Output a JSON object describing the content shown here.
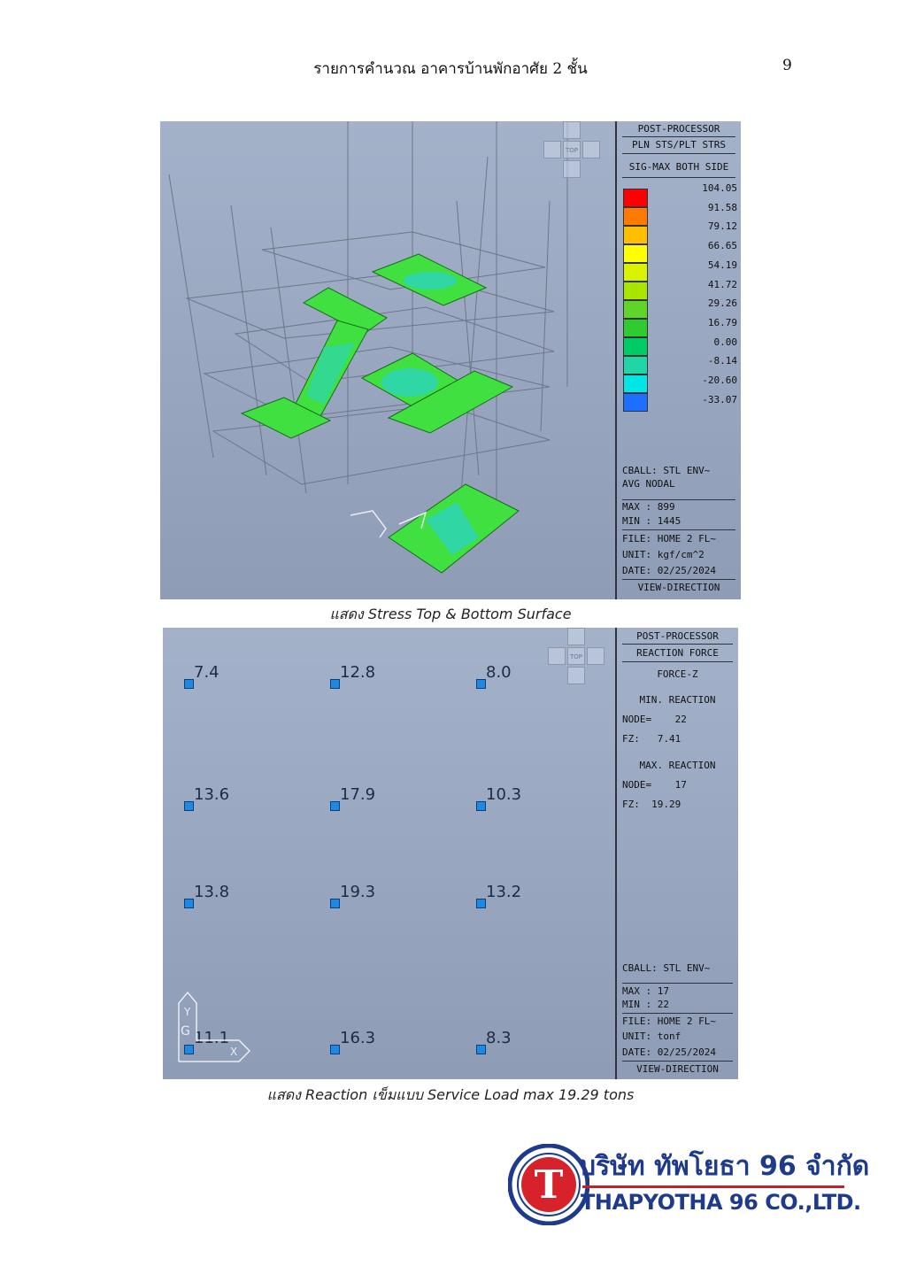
{
  "header": {
    "title": "รายการคำนวณ อาคารบ้านพักอาศัย 2 ชั้น",
    "page_number": "9"
  },
  "view_cube": {
    "top_label": "TOP"
  },
  "panel_stress": {
    "processor": "POST-PROCESSOR",
    "mode": "PLN STS/PLT STRS",
    "component": "SIG-MAX BOTH SIDE",
    "legend": [
      {
        "value": "104.05",
        "color": "#ff0000"
      },
      {
        "value": "91.58",
        "color": "#ff7a00"
      },
      {
        "value": "79.12",
        "color": "#ffbf00"
      },
      {
        "value": "66.65",
        "color": "#ffff00"
      },
      {
        "value": "54.19",
        "color": "#d9f200"
      },
      {
        "value": "41.72",
        "color": "#a8e600"
      },
      {
        "value": "29.26",
        "color": "#5fd52a"
      },
      {
        "value": "16.79",
        "color": "#2ecc2e"
      },
      {
        "value": "0.00",
        "color": "#00cc66"
      },
      {
        "value": "-8.14",
        "color": "#20d6a6"
      },
      {
        "value": "-20.60",
        "color": "#00e5e5"
      },
      {
        "value": "-33.07",
        "color": "#1e6fff"
      }
    ],
    "cball": "CBALL: STL ENV~",
    "avg": "AVG NODAL",
    "max": "MAX : 899",
    "min": "MIN : 1445",
    "file": "FILE: HOME 2 FL~",
    "unit": "UNIT: kgf/cm^2",
    "date": "DATE: 02/25/2024",
    "view": "VIEW-DIRECTION"
  },
  "caption_stress": "แสดง Stress Top & Bottom Surface",
  "panel_reaction": {
    "processor": "POST-PROCESSOR",
    "mode": "REACTION FORCE",
    "component": "FORCE-Z",
    "min_title": "MIN. REACTION",
    "min_node": "NODE=    22",
    "min_fz": "FZ:   7.41",
    "max_title": "MAX. REACTION",
    "max_node": "NODE=    17",
    "max_fz": "FZ:  19.29",
    "cball": "CBALL: STL ENV~",
    "max": "MAX : 17",
    "min": "MIN : 22",
    "file": "FILE: HOME 2 FL~",
    "unit": "UNIT: tonf",
    "date": "DATE: 02/25/2024",
    "view": "VIEW-DIRECTION",
    "nodes": [
      "7.4",
      "12.8",
      "8.0",
      "13.6",
      "17.9",
      "10.3",
      "13.8",
      "19.3",
      "13.2",
      "11.1",
      "16.3",
      "8.3"
    ],
    "axis_y": "Y",
    "axis_x": "X"
  },
  "caption_reaction": "แสดง Reaction เข็มแบบ Service Load max 19.29 tons",
  "logo": {
    "thai": "บริษัท ทัพโยธา 96 จำกัด",
    "english": "THAPYOTHA 96 CO.,LTD.",
    "mark": "T"
  }
}
